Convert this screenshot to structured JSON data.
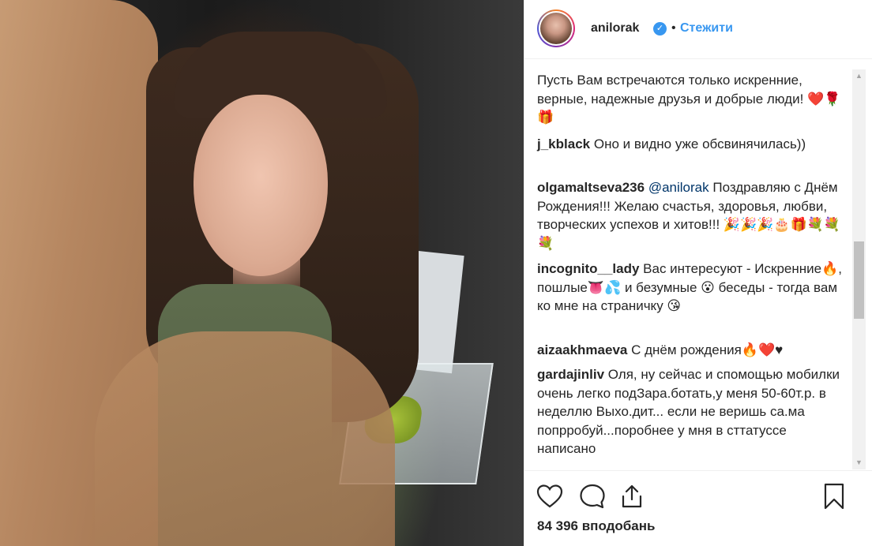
{
  "header": {
    "username": "anilorak",
    "verified_mark": "✓",
    "separator": "•",
    "follow_label": "Стежити"
  },
  "comments": [
    {
      "user": "",
      "text": "Пусть Вам встречаются только искренние, верные, надежные друзья и добрые люди! ❤️🌹🎁"
    },
    {
      "user": "j_kblack",
      "text": "Оно и видно уже обсвинячилась))"
    },
    {
      "user": "olgamaltseva236",
      "mention": "@anilorak",
      "text": "Поздравляю с Днём Рождения!!! Желаю счастья, здоровья, любви, творческих успехов и хитов!!! 🎉🎉🎉🎂🎁💐💐💐"
    },
    {
      "user": "incognito__lady",
      "text": "Вас интересуют - Искренние🔥, пошлые👅💦 и безумные 😮 беседы - тогда вам ко мне на страничку 😘"
    },
    {
      "user": "aizaakhmaeva",
      "text": "С днём рождения🔥❤️♥"
    },
    {
      "user": "gardajinliv",
      "text": "Оля, ну сейчас и спомощью мобилки очень легко подЗара.ботать,у меня 50-60т.р. в неделлю Выхо.дит... если не веришь са.ма попрробуй...поробнее у мня в сттатуссе написано"
    }
  ],
  "actions": {
    "like_icon": "heart-icon",
    "comment_icon": "comment-icon",
    "share_icon": "share-icon",
    "save_icon": "bookmark-icon"
  },
  "likes_text": "84 396 вподобань",
  "scrollbar": {
    "up": "▲",
    "down": "▼"
  },
  "colors": {
    "link": "#3897f0",
    "verified": "#3897f0",
    "text": "#262626",
    "mention": "#003569"
  }
}
